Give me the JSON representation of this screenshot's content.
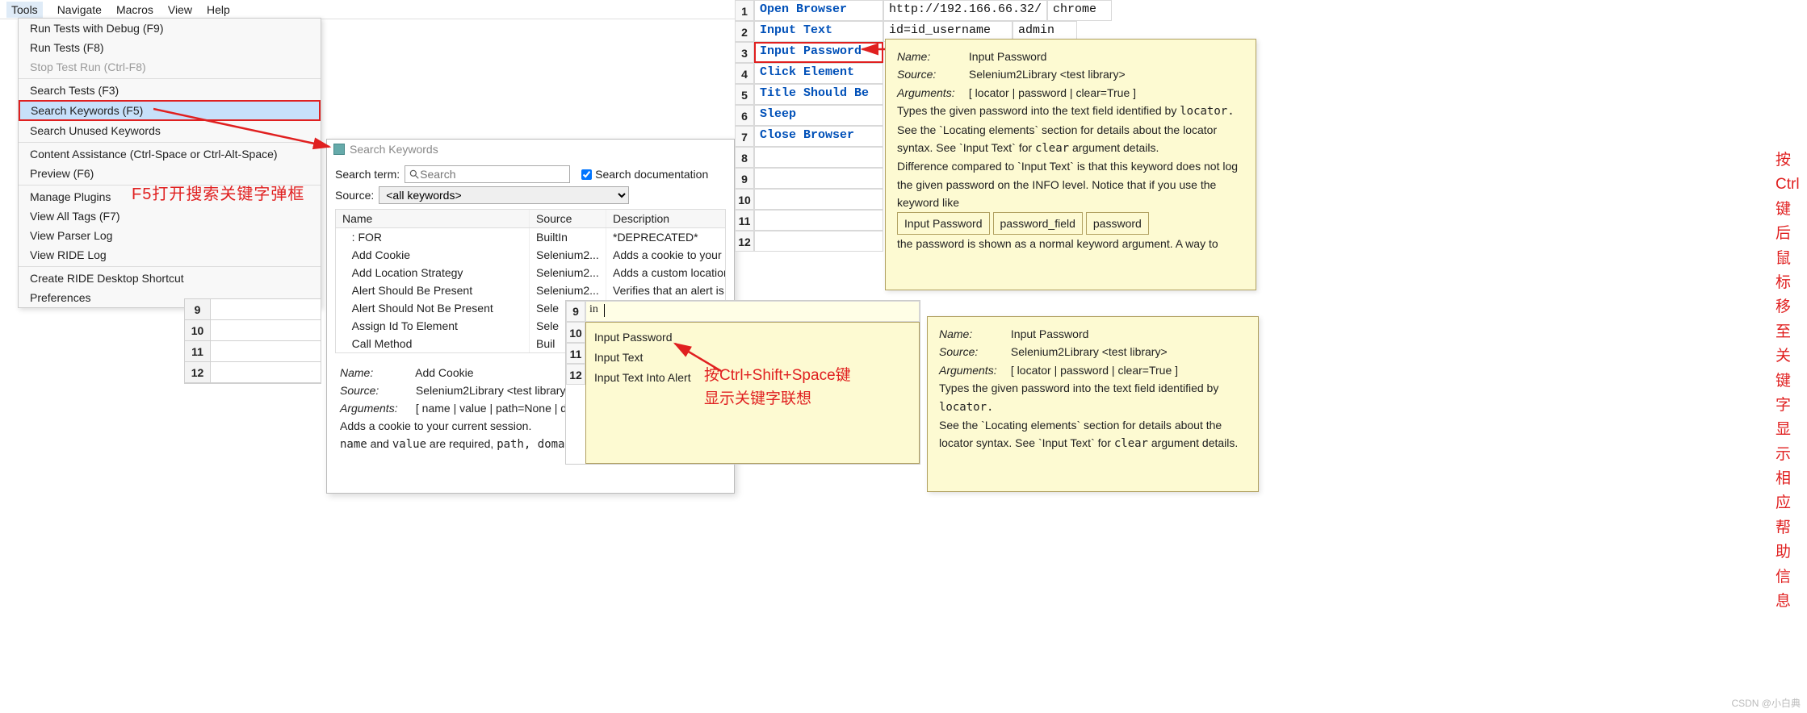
{
  "menu": {
    "items": [
      "Tools",
      "Navigate",
      "Macros",
      "View",
      "Help"
    ],
    "selectedIndex": 0
  },
  "dropdown": {
    "groups": [
      [
        {
          "label": "Run Tests with Debug",
          "accel": "(F9)"
        },
        {
          "label": "Run Tests",
          "accel": "(F8)"
        },
        {
          "label": "Stop Test Run",
          "accel": "(Ctrl-F8)",
          "disabled": true
        }
      ],
      [
        {
          "label": "Search Tests",
          "accel": "(F3)"
        },
        {
          "label": "Search Keywords",
          "accel": "(F5)",
          "selected": true,
          "boxed": true
        },
        {
          "label": "Search Unused Keywords",
          "accel": ""
        }
      ],
      [
        {
          "label": "Content Assistance",
          "accel": "(Ctrl-Space or Ctrl-Alt-Space)"
        },
        {
          "label": "Preview",
          "accel": "(F6)"
        }
      ],
      [
        {
          "label": "Manage Plugins",
          "accel": ""
        },
        {
          "label": "View All Tags",
          "accel": "(F7)"
        },
        {
          "label": "View Parser Log",
          "accel": ""
        },
        {
          "label": "View RIDE Log",
          "accel": ""
        }
      ],
      [
        {
          "label": "Create RIDE Desktop Shortcut",
          "accel": ""
        },
        {
          "label": "Preferences",
          "accel": ""
        }
      ]
    ]
  },
  "annotations": {
    "f5_note": "F5打开搜索关键字弹框",
    "ctrl_hover_note": "按Ctrl键后鼠标移至关键字显示相应帮助信息",
    "ctrl_shift_space_l1": "按Ctrl+Shift+Space键",
    "ctrl_shift_space_l2": "显示关键字联想",
    "watermark": "CSDN @小白典"
  },
  "search_window": {
    "title": "Search Keywords",
    "term_label": "Search term:",
    "placeholder": "Search",
    "doc_checkbox": "Search documentation",
    "source_label": "Source:",
    "source_value": "<all keywords>",
    "columns": [
      "Name",
      "Source",
      "Description"
    ],
    "rows": [
      {
        "name": ": FOR",
        "source": "BuiltIn",
        "desc": "*DEPRECATED*"
      },
      {
        "name": "Add Cookie",
        "source": "Selenium2...",
        "desc": "Adds a cookie to your cu"
      },
      {
        "name": "Add Location Strategy",
        "source": "Selenium2...",
        "desc": "Adds a custom location s"
      },
      {
        "name": "Alert Should Be Present",
        "source": "Selenium2...",
        "desc": "Verifies that an alert is p"
      },
      {
        "name": "Alert Should Not Be Present",
        "source": "Sele",
        "desc": ""
      },
      {
        "name": "Assign Id To Element",
        "source": "Sele",
        "desc": ""
      },
      {
        "name": "Call Method",
        "source": "Buil",
        "desc": ""
      }
    ],
    "detail": {
      "name_label": "Name:",
      "name_value": "Add Cookie",
      "source_label": "Source:",
      "source_value": "Selenium2Library <test library>",
      "args_label": "Arguments:",
      "args_value": "[ name | value | path=None | dom",
      "p1": "Adds a cookie to your current session.",
      "p2_a": "name",
      "p2_b": "and",
      "p2_c": "value",
      "p2_d": "are required,",
      "p2_e": "path, domain, secur"
    }
  },
  "main_grid": {
    "rows": [
      {
        "n": "1",
        "kw": "Open Browser",
        "c2": "http://192.166.66.32/",
        "c3": "chrome"
      },
      {
        "n": "2",
        "kw": "Input Text",
        "c2": "id=id_username",
        "c3": "admin"
      },
      {
        "n": "3",
        "kw": "Input Password",
        "highlight": true
      },
      {
        "n": "4",
        "kw": "Click Element"
      },
      {
        "n": "5",
        "kw": "Title Should Be"
      },
      {
        "n": "6",
        "kw": "Sleep"
      },
      {
        "n": "7",
        "kw": "Close Browser"
      },
      {
        "n": "8",
        "kw": ""
      },
      {
        "n": "9",
        "kw": ""
      },
      {
        "n": "10",
        "kw": ""
      },
      {
        "n": "11",
        "kw": ""
      },
      {
        "n": "12",
        "kw": ""
      }
    ]
  },
  "mini_grid": {
    "rows": [
      "9",
      "10",
      "11",
      "12"
    ]
  },
  "tooltip1": {
    "name_label": "Name:",
    "name_value": "Input Password",
    "source_label": "Source:",
    "source_value": "Selenium2Library <test library>",
    "args_label": "Arguments:",
    "args_value": "[ locator | password | clear=True ]",
    "p1a": "Types the given password into the text field identified by ",
    "p1b": "locator.",
    "p2a": "See the `Locating elements` section for details about the locator syntax. See `Input Text` for ",
    "p2b": "clear",
    "p2c": " argument details.",
    "p3": "Difference compared to `Input Text` is that this keyword does not log the given password on the INFO level. Notice that if you use the keyword like",
    "boxes": [
      "Input Password",
      "password_field",
      "password"
    ],
    "p4": "the password is shown as a normal keyword argument. A way to"
  },
  "autocomplete": {
    "edit_row": "9",
    "edit_text": "in",
    "side_rows": [
      "10",
      "11",
      "12"
    ],
    "items": [
      "Input Password",
      "Input Text",
      "Input Text Into Alert"
    ]
  },
  "tooltip2": {
    "name_label": "Name:",
    "name_value": "Input Password",
    "source_label": "Source:",
    "source_value": "Selenium2Library <test library>",
    "args_label": "Arguments:",
    "args_value": "[ locator | password | clear=True ]",
    "p1a": "Types the given password into the text field identified by ",
    "p1b": "locator.",
    "p2a": "See the `Locating elements` section for details about the locator syntax. See `Input Text` for ",
    "p2b": "clear",
    "p2c": " argument details."
  }
}
